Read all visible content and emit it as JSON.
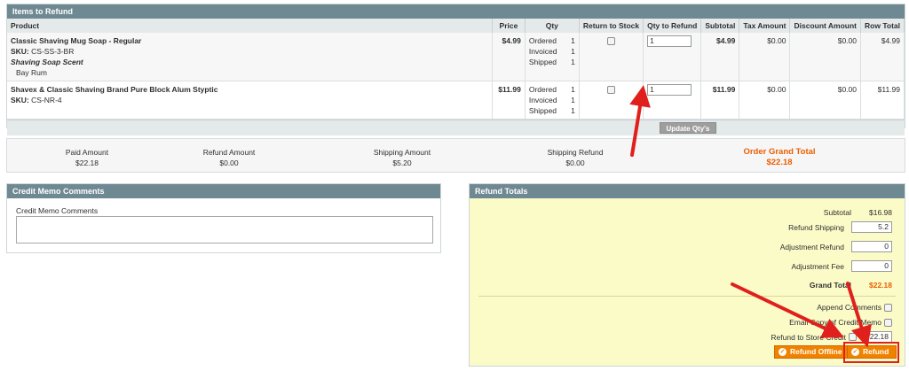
{
  "items_section": {
    "title": "Items to Refund",
    "columns": [
      "Product",
      "Price",
      "Qty",
      "Return to Stock",
      "Qty to Refund",
      "Subtotal",
      "Tax Amount",
      "Discount Amount",
      "Row Total"
    ],
    "rows": [
      {
        "name": "Classic Shaving Mug Soap - Regular",
        "sku_label": "SKU:",
        "sku": "CS-SS-3-BR",
        "option_label": "Shaving Soap Scent",
        "option_value": "Bay Rum",
        "price": "$4.99",
        "ordered_label": "Ordered",
        "ordered": "1",
        "invoiced_label": "Invoiced",
        "invoiced": "1",
        "shipped_label": "Shipped",
        "shipped": "1",
        "qty_to_refund": "1",
        "subtotal": "$4.99",
        "tax": "$0.00",
        "discount": "$0.00",
        "row_total": "$4.99"
      },
      {
        "name": "Shavex & Classic Shaving Brand Pure Block Alum Styptic",
        "sku_label": "SKU:",
        "sku": "CS-NR-4",
        "price": "$11.99",
        "ordered_label": "Ordered",
        "ordered": "1",
        "invoiced_label": "Invoiced",
        "invoiced": "1",
        "shipped_label": "Shipped",
        "shipped": "1",
        "qty_to_refund": "1",
        "subtotal": "$11.99",
        "tax": "$0.00",
        "discount": "$0.00",
        "row_total": "$11.99"
      }
    ],
    "update_button": "Update Qty's"
  },
  "totals_bar": {
    "paid_label": "Paid Amount",
    "paid": "$22.18",
    "refund_label": "Refund Amount",
    "refund": "$0.00",
    "shipping_label": "Shipping Amount",
    "shipping": "$5.20",
    "shipping_refund_label": "Shipping Refund",
    "shipping_refund": "$0.00",
    "grand_label": "Order Grand Total",
    "grand": "$22.18"
  },
  "comments": {
    "title": "Credit Memo Comments",
    "field_label": "Credit Memo Comments",
    "value": ""
  },
  "refund_totals": {
    "title": "Refund Totals",
    "subtotal_label": "Subtotal",
    "subtotal": "$16.98",
    "refund_shipping_label": "Refund Shipping",
    "refund_shipping": "5.2",
    "adjustment_refund_label": "Adjustment Refund",
    "adjustment_refund": "0",
    "adjustment_fee_label": "Adjustment Fee",
    "adjustment_fee": "0",
    "grand_total_label": "Grand Total",
    "grand_total": "$22.18",
    "append_comments_label": "Append Comments",
    "email_copy_label": "Email Copy of Credit Memo",
    "store_credit_label": "Refund to Store Credit",
    "store_credit_value": "22.18",
    "refund_offline_button": "Refund Offline",
    "refund_button": "Refund"
  },
  "colors": {
    "header_bg": "#6f8992",
    "accent_orange": "#eb5e00",
    "button_orange": "#f18200",
    "panel_yellow": "#fbfbc8",
    "annotation_red": "#e0201c"
  }
}
